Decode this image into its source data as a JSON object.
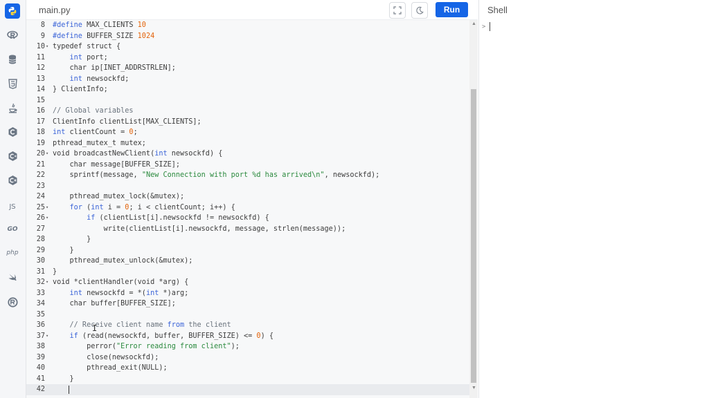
{
  "file_tab": "main.py",
  "run_label": "Run",
  "shell_title": "Shell",
  "shell_prompt": ">",
  "sidebar_icons": [
    "python-icon",
    "r-icon",
    "database-icon",
    "html5-icon",
    "java-icon",
    "c-icon",
    "cpp-icon",
    "csharp-icon",
    "javascript-icon",
    "go-icon",
    "php-icon",
    "swift-icon",
    "rust-icon"
  ],
  "sidebar_labels": {
    "javascript": "JS",
    "go": "GO",
    "php": "php"
  },
  "lines": [
    {
      "n": "8",
      "fold": false,
      "t": [
        [
          "kw",
          "#define"
        ],
        [
          "p",
          " MAX_CLIENTS "
        ],
        [
          "num",
          "10"
        ]
      ]
    },
    {
      "n": "9",
      "fold": false,
      "t": [
        [
          "kw",
          "#define"
        ],
        [
          "p",
          " BUFFER_SIZE "
        ],
        [
          "num",
          "1024"
        ]
      ]
    },
    {
      "n": "10",
      "fold": true,
      "t": [
        [
          "p",
          "typedef struct {"
        ]
      ]
    },
    {
      "n": "11",
      "fold": false,
      "t": [
        [
          "kw",
          "    int"
        ],
        [
          "p",
          " port;"
        ]
      ]
    },
    {
      "n": "12",
      "fold": false,
      "t": [
        [
          "p",
          "    char ip[INET_ADDRSTRLEN];"
        ]
      ]
    },
    {
      "n": "13",
      "fold": false,
      "t": [
        [
          "kw",
          "    int"
        ],
        [
          "p",
          " newsockfd;"
        ]
      ]
    },
    {
      "n": "14",
      "fold": false,
      "t": [
        [
          "p",
          "} ClientInfo;"
        ]
      ]
    },
    {
      "n": "15",
      "fold": false,
      "t": []
    },
    {
      "n": "16",
      "fold": false,
      "t": [
        [
          "com",
          "// Global variables"
        ]
      ]
    },
    {
      "n": "17",
      "fold": false,
      "t": [
        [
          "p",
          "ClientInfo clientList[MAX_CLIENTS];"
        ]
      ]
    },
    {
      "n": "18",
      "fold": false,
      "t": [
        [
          "kw",
          "int"
        ],
        [
          "p",
          " clientCount = "
        ],
        [
          "num",
          "0"
        ],
        [
          "p",
          ";"
        ]
      ]
    },
    {
      "n": "19",
      "fold": false,
      "t": [
        [
          "p",
          "pthread_mutex_t mutex;"
        ]
      ]
    },
    {
      "n": "20",
      "fold": true,
      "t": [
        [
          "p",
          "void broadcastNewClient("
        ],
        [
          "kw",
          "int"
        ],
        [
          "p",
          " newsockfd) {"
        ]
      ]
    },
    {
      "n": "21",
      "fold": false,
      "t": [
        [
          "p",
          "    char message[BUFFER_SIZE];"
        ]
      ]
    },
    {
      "n": "22",
      "fold": false,
      "t": [
        [
          "p",
          "    sprintf(message, "
        ],
        [
          "str",
          "\"New Connection with port %d has arrived\\n\""
        ],
        [
          "p",
          ", newsockfd);"
        ]
      ]
    },
    {
      "n": "23",
      "fold": false,
      "t": []
    },
    {
      "n": "24",
      "fold": false,
      "t": [
        [
          "p",
          "    pthread_mutex_lock(&mutex);"
        ]
      ]
    },
    {
      "n": "25",
      "fold": true,
      "t": [
        [
          "kw",
          "    for"
        ],
        [
          "p",
          " ("
        ],
        [
          "kw",
          "int"
        ],
        [
          "p",
          " i = "
        ],
        [
          "num",
          "0"
        ],
        [
          "p",
          "; i < clientCount; i++) {"
        ]
      ]
    },
    {
      "n": "26",
      "fold": true,
      "t": [
        [
          "kw",
          "        if"
        ],
        [
          "p",
          " (clientList[i].newsockfd != newsockfd) {"
        ]
      ]
    },
    {
      "n": "27",
      "fold": false,
      "t": [
        [
          "p",
          "            write(clientList[i].newsockfd, message, strlen(message));"
        ]
      ]
    },
    {
      "n": "28",
      "fold": false,
      "t": [
        [
          "p",
          "        }"
        ]
      ]
    },
    {
      "n": "29",
      "fold": false,
      "t": [
        [
          "p",
          "    }"
        ]
      ]
    },
    {
      "n": "30",
      "fold": false,
      "t": [
        [
          "p",
          "    pthread_mutex_unlock(&mutex);"
        ]
      ]
    },
    {
      "n": "31",
      "fold": false,
      "t": [
        [
          "p",
          "}"
        ]
      ]
    },
    {
      "n": "32",
      "fold": true,
      "t": [
        [
          "p",
          "void *clientHandler(void *arg) {"
        ]
      ]
    },
    {
      "n": "33",
      "fold": false,
      "t": [
        [
          "kw",
          "    int"
        ],
        [
          "p",
          " newsockfd = *("
        ],
        [
          "kw",
          "int"
        ],
        [
          "p",
          " *)arg;"
        ]
      ]
    },
    {
      "n": "34",
      "fold": false,
      "t": [
        [
          "p",
          "    char buffer[BUFFER_SIZE];"
        ]
      ]
    },
    {
      "n": "35",
      "fold": false,
      "t": []
    },
    {
      "n": "36",
      "fold": false,
      "t": [
        [
          "com",
          "    // Receive client name "
        ],
        [
          "kw",
          "from"
        ],
        [
          "com",
          " the client"
        ]
      ]
    },
    {
      "n": "37",
      "fold": true,
      "t": [
        [
          "kw",
          "    if"
        ],
        [
          "p",
          " (read(newsockfd, buffer, BUFFER_SIZE) <= "
        ],
        [
          "num",
          "0"
        ],
        [
          "p",
          ") {"
        ]
      ]
    },
    {
      "n": "38",
      "fold": false,
      "t": [
        [
          "p",
          "        perror("
        ],
        [
          "str",
          "\"Error reading from client\""
        ],
        [
          "p",
          ");"
        ]
      ]
    },
    {
      "n": "39",
      "fold": false,
      "t": [
        [
          "p",
          "        close(newsockfd);"
        ]
      ]
    },
    {
      "n": "40",
      "fold": false,
      "t": [
        [
          "p",
          "        pthread_exit(NULL);"
        ]
      ]
    },
    {
      "n": "41",
      "fold": false,
      "t": [
        [
          "p",
          "    }"
        ]
      ]
    },
    {
      "n": "42",
      "fold": false,
      "current": true,
      "t": []
    }
  ]
}
